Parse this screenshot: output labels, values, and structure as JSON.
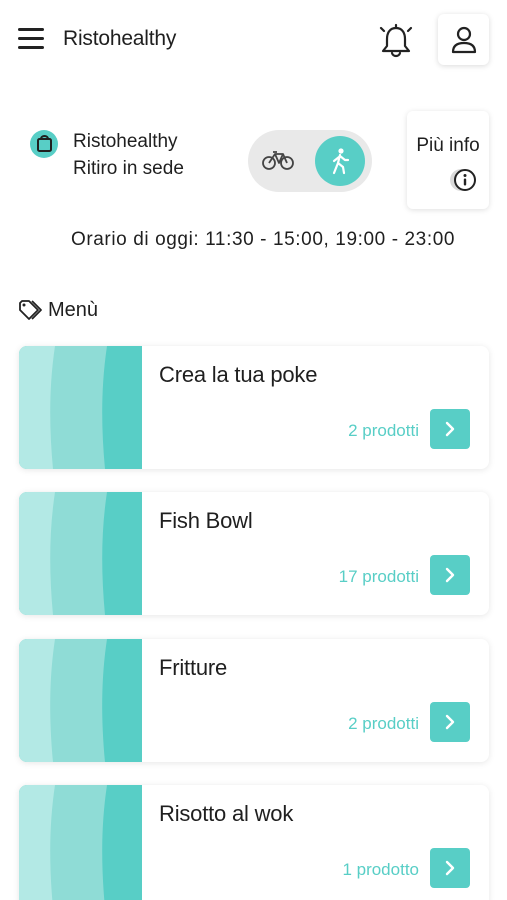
{
  "header": {
    "app_title": "Ristohealthy"
  },
  "store": {
    "name": "Ristohealthy",
    "mode": "Ritiro in sede"
  },
  "info_button": {
    "label": "Più info"
  },
  "hours": {
    "text": "Orario di oggi: 11:30 - 15:00, 19:00 - 23:00"
  },
  "menu": {
    "heading": "Menù",
    "categories": [
      {
        "title": "Crea la tua poke",
        "count": "2 prodotti"
      },
      {
        "title": "Fish Bowl",
        "count": "17 prodotti"
      },
      {
        "title": "Fritture",
        "count": "2 prodotti"
      },
      {
        "title": "Risotto al wok",
        "count": "1 prodotto"
      }
    ]
  },
  "colors": {
    "accent": "#58cec6",
    "accent_light": "#b3e9e5",
    "accent_mid": "#8fdcd6"
  }
}
